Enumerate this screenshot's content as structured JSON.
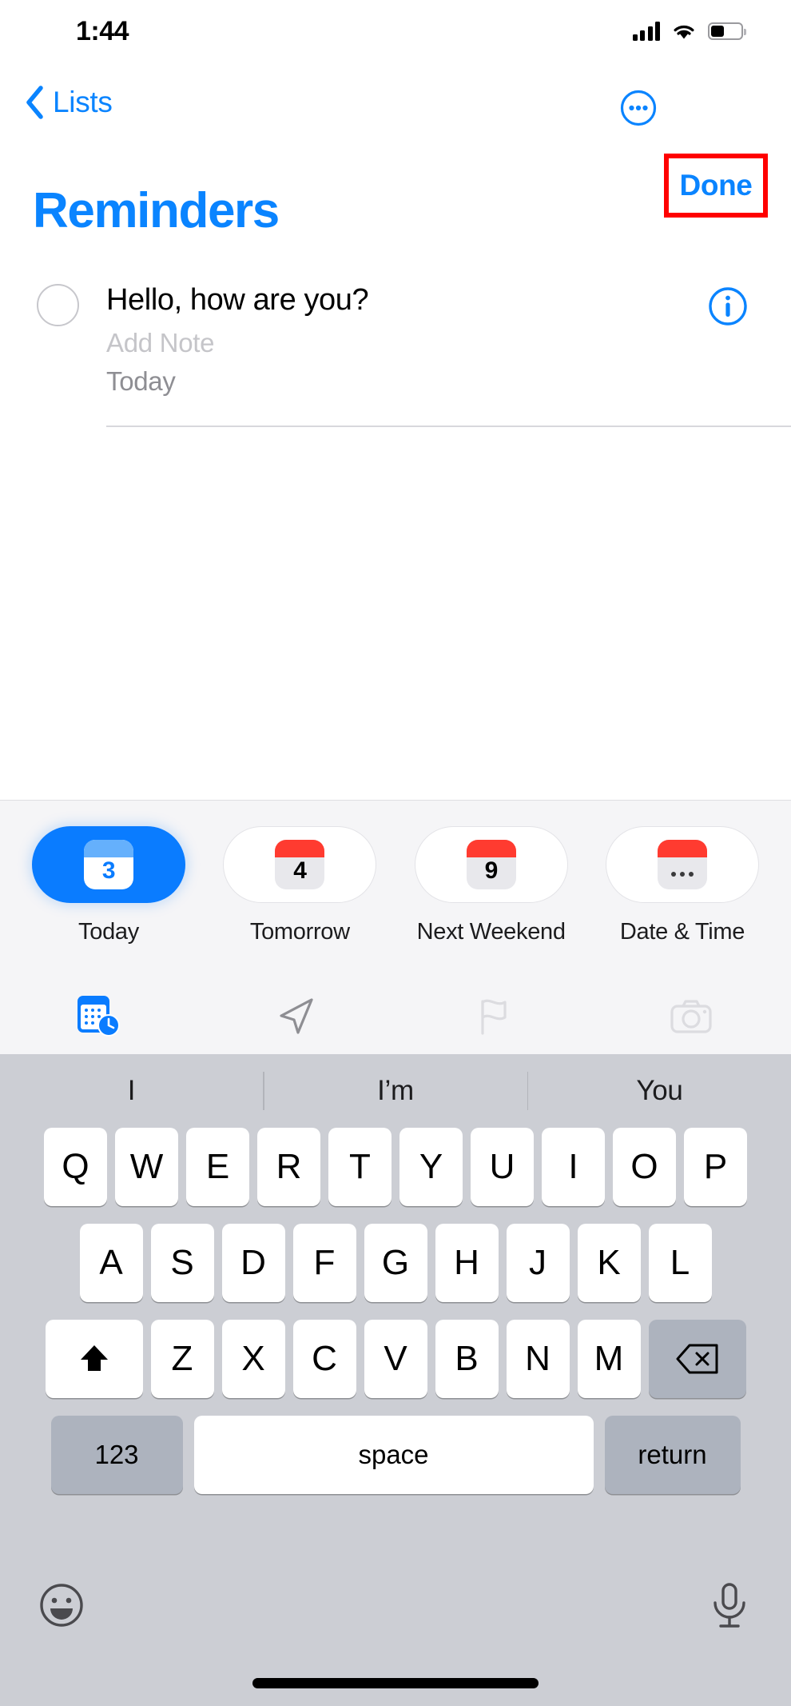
{
  "status_bar": {
    "time": "1:44",
    "cellular_icon": "signal-bars-icon",
    "wifi_icon": "wifi-icon",
    "battery_icon": "battery-icon",
    "battery_level_percent": 45
  },
  "nav_bar": {
    "back_label": "Lists",
    "back_icon": "chevron-left-icon",
    "more_icon": "ellipsis-circle-icon",
    "done_label": "Done",
    "highlight_color": "#ff0000",
    "accent_color": "#0a84ff"
  },
  "list": {
    "title": "Reminders",
    "title_color": "#0a84ff"
  },
  "reminder": {
    "checkbox_icon": "empty-circle-icon",
    "title": "Hello, how are you?",
    "note_placeholder": "Add Note",
    "date_label": "Today",
    "info_icon": "info-circle-icon"
  },
  "date_suggestions": {
    "chips": [
      {
        "label": "Today",
        "day_number": "3",
        "active": true,
        "icon": "calendar-day-icon"
      },
      {
        "label": "Tomorrow",
        "day_number": "4",
        "active": false,
        "icon": "calendar-day-icon"
      },
      {
        "label": "Next Weekend",
        "day_number": "9",
        "active": false,
        "icon": "calendar-day-icon"
      },
      {
        "label": "Date & Time",
        "day_number": "…",
        "active": false,
        "icon": "calendar-more-icon"
      }
    ],
    "actions": [
      {
        "name": "calendar-clock-icon",
        "state": "active"
      },
      {
        "name": "location-arrow-icon",
        "state": "enabled"
      },
      {
        "name": "flag-icon",
        "state": "disabled"
      },
      {
        "name": "camera-icon",
        "state": "disabled"
      }
    ],
    "active_color": "#0a7cff"
  },
  "keyboard": {
    "predictions": [
      "I",
      "I’m",
      "You"
    ],
    "row1": [
      "Q",
      "W",
      "E",
      "R",
      "T",
      "Y",
      "U",
      "I",
      "O",
      "P"
    ],
    "row2": [
      "A",
      "S",
      "D",
      "F",
      "G",
      "H",
      "J",
      "K",
      "L"
    ],
    "row3": [
      "Z",
      "X",
      "C",
      "V",
      "B",
      "N",
      "M"
    ],
    "shift_icon": "shift-up-arrow-icon",
    "backspace_icon": "backspace-delete-icon",
    "numbers_label": "123",
    "space_label": "space",
    "return_label": "return",
    "emoji_icon": "emoji-smiley-icon",
    "mic_icon": "microphone-icon"
  }
}
